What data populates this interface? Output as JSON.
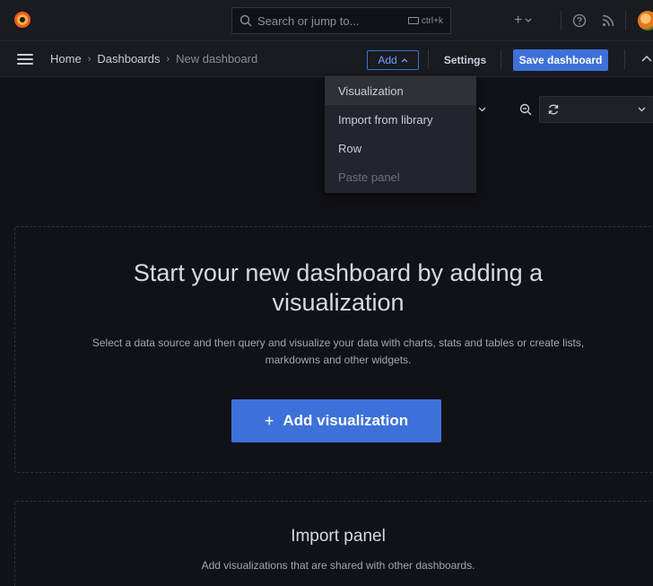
{
  "topbar": {
    "search_placeholder": "Search or jump to...",
    "search_shortcut": "ctrl+k",
    "plus_label": "+"
  },
  "breadcrumb": {
    "home": "Home",
    "dashboards": "Dashboards",
    "current": "New dashboard"
  },
  "toolbar": {
    "add_label": "Add",
    "settings_label": "Settings",
    "save_label": "Save dashboard"
  },
  "add_menu": {
    "items": [
      {
        "label": "Visualization",
        "state": "hovered"
      },
      {
        "label": "Import from library",
        "state": "normal"
      },
      {
        "label": "Row",
        "state": "normal"
      },
      {
        "label": "Paste panel",
        "state": "disabled"
      }
    ]
  },
  "empty_state": {
    "title": "Start your new dashboard by adding a visualization",
    "description": "Select a data source and then query and visualize your data with charts, stats and tables or create lists, markdowns and other widgets.",
    "button_label": "Add visualization"
  },
  "import_panel": {
    "title": "Import panel",
    "description": "Add visualizations that are shared with other dashboards."
  },
  "colors": {
    "background": "#111217",
    "panel": "#181b1f",
    "primary": "#3d71d9",
    "text": "#ccccdc"
  },
  "icons": [
    "grafana-logo-icon",
    "search-icon",
    "keyboard-icon",
    "plus-icon",
    "help-icon",
    "rss-icon",
    "hamburger-icon",
    "chevron-up-icon",
    "zoom-out-icon",
    "refresh-icon",
    "chevron-down-icon"
  ]
}
